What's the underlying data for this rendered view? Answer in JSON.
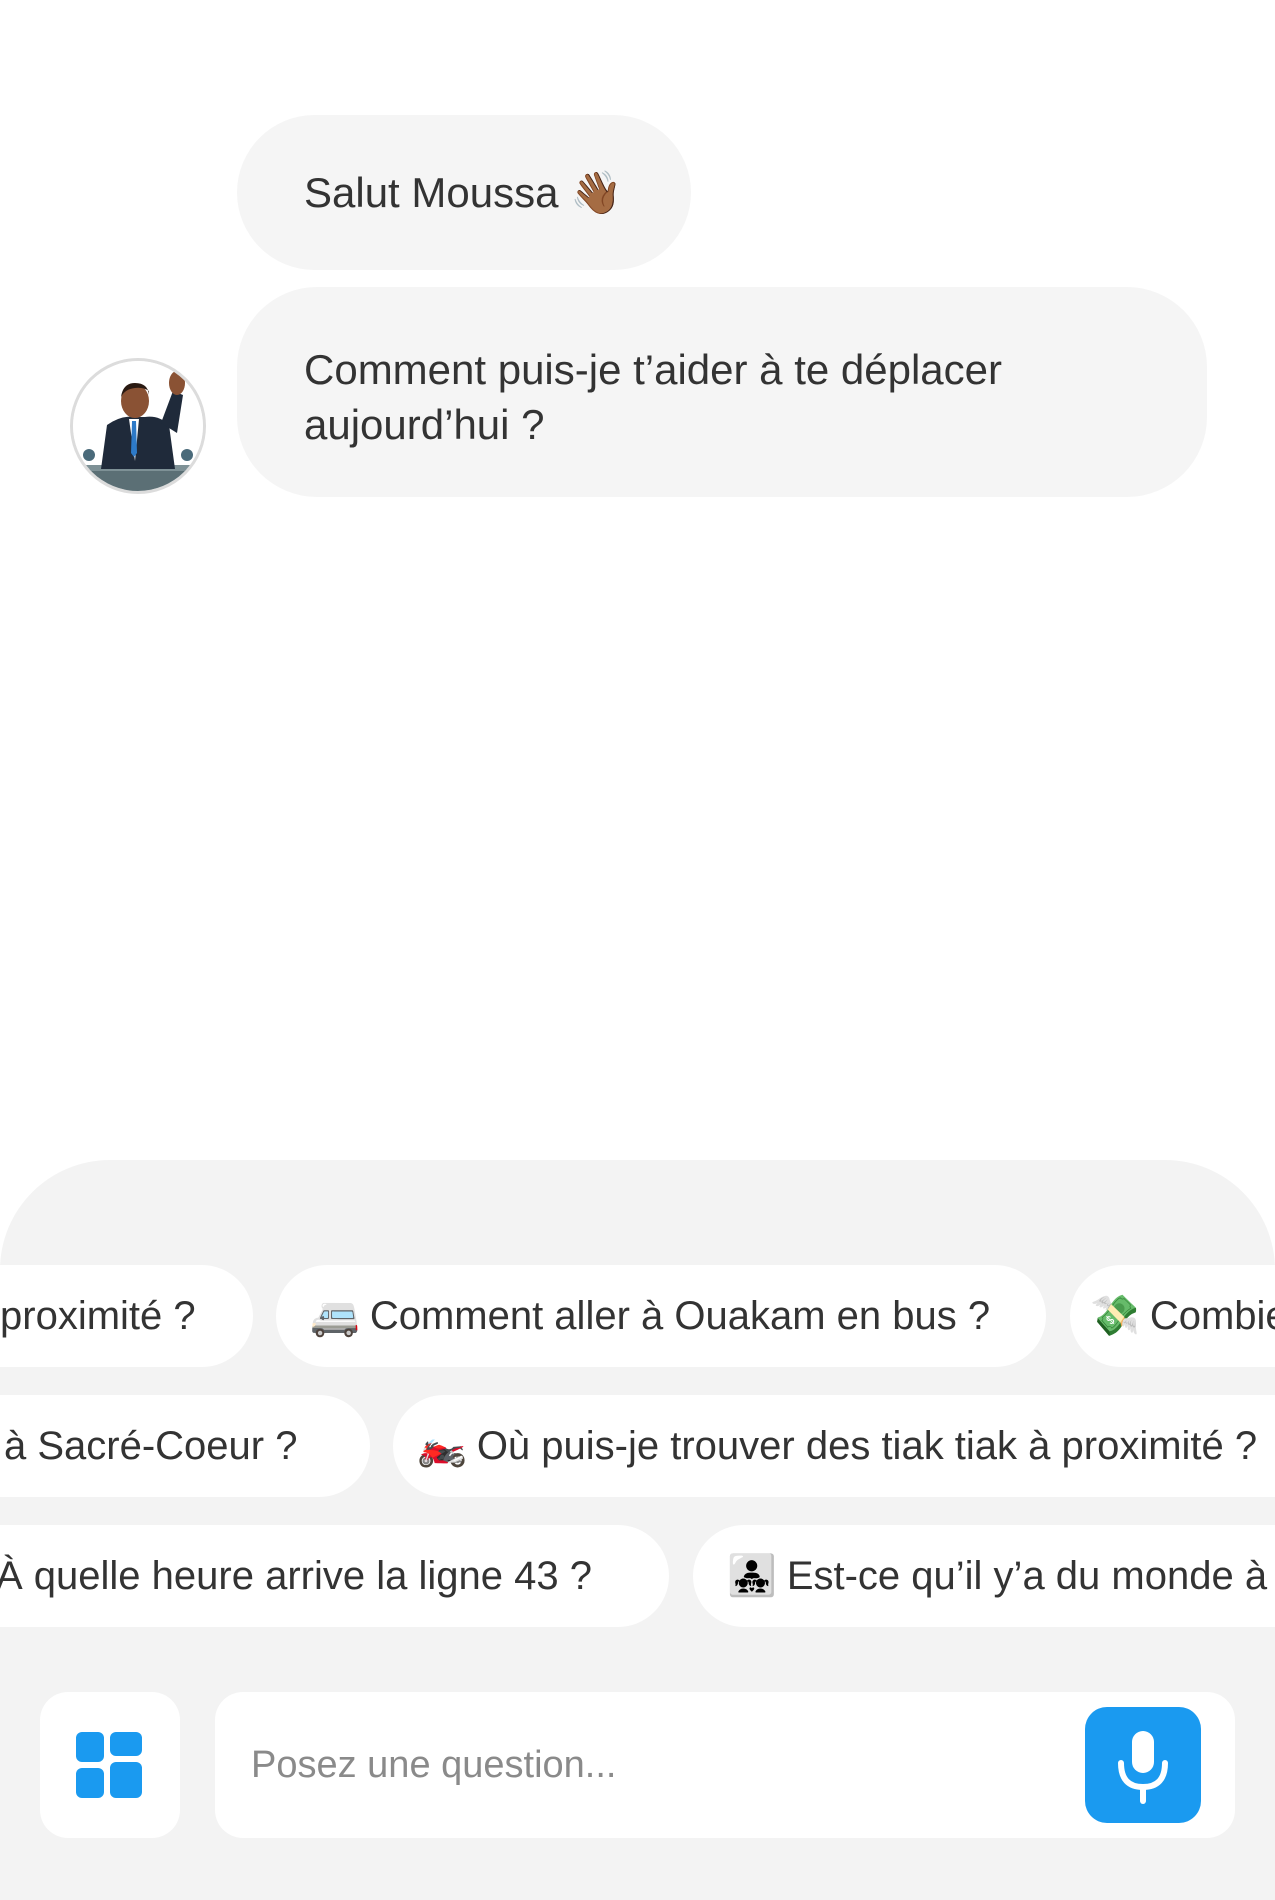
{
  "chat": {
    "greeting_text": "Salut Moussa",
    "greeting_emoji": "👋🏾",
    "question_text": "Comment puis-je t’aider à te déplacer aujourd’hui ?"
  },
  "suggestions": {
    "row1": [
      {
        "emoji": "",
        "text": "proximité ?"
      },
      {
        "emoji": "🚐",
        "text": "Comment aller à Ouakam en bus ?"
      },
      {
        "emoji": "💸",
        "text": "Combie"
      }
    ],
    "row2": [
      {
        "emoji": "",
        "text": "à Sacré-Coeur ?"
      },
      {
        "emoji": "🏍️",
        "text": "Où puis-je trouver des tiak tiak à proximité ?"
      }
    ],
    "row3": [
      {
        "emoji": "",
        "text": "À quelle heure arrive la ligne 43 ?"
      },
      {
        "emoji": "👨‍👧‍👧",
        "text": "Est-ce qu’il y’a du monde à"
      }
    ]
  },
  "composer": {
    "placeholder": "Posez  une question...",
    "menu_icon": "grid-icon",
    "mic_icon": "microphone-icon"
  },
  "colors": {
    "accent": "#1a9af0",
    "bubble_bg": "#f5f5f5",
    "panel_bg": "#f3f3f3"
  }
}
